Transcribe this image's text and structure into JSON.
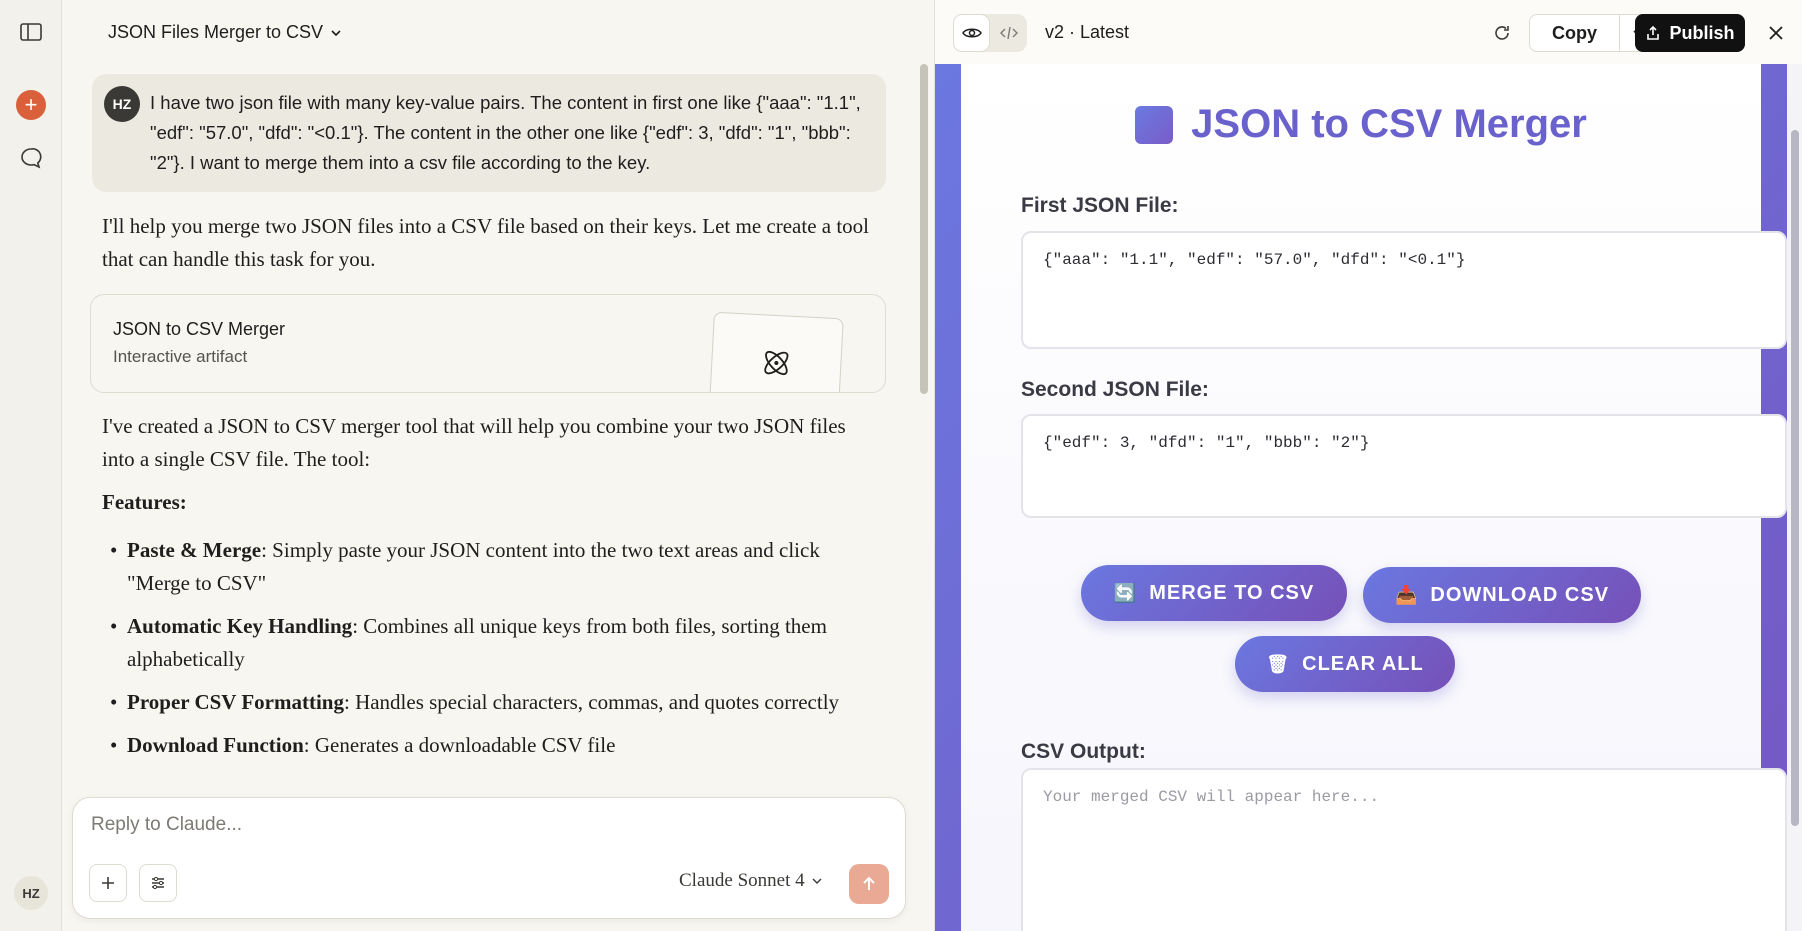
{
  "rail": {
    "user_initials": "HZ"
  },
  "chat": {
    "title": "JSON Files Merger to CSV",
    "user_initials": "HZ",
    "user_message": "I have two json file with many key-value pairs. The content in first one like {\"aaa\": \"1.1\", \"edf\": \"57.0\", \"dfd\": \"<0.1\"}. The content in the other one like {\"edf\": 3, \"dfd\": \"1\", \"bbb\": \"2\"}. I want to merge them into a csv file according to the key.",
    "reply_intro": "I'll help you merge two JSON files into a CSV file based on their keys. Let me create a tool that can handle this task for you.",
    "artifact_card": {
      "title": "JSON to CSV Merger",
      "subtitle": "Interactive artifact"
    },
    "reply_body": "I've created a JSON to CSV merger tool that will help you combine your two JSON files into a single CSV file. The tool:",
    "features_heading": "Features:",
    "features": [
      {
        "title": "Paste & Merge",
        "text": ": Simply paste your JSON content into the two text areas and click \"Merge to CSV\""
      },
      {
        "title": "Automatic Key Handling",
        "text": ": Combines all unique keys from both files, sorting them alphabetically"
      },
      {
        "title": "Proper CSV Formatting",
        "text": ": Handles special characters, commas, and quotes correctly"
      },
      {
        "title": "Download Function",
        "text": ": Generates a downloadable CSV file"
      }
    ],
    "reply_box": {
      "placeholder": "Reply to Claude...",
      "model": "Claude Sonnet 4"
    }
  },
  "artifact_header": {
    "version": "v2 · Latest",
    "copy_label": "Copy",
    "publish_label": "Publish"
  },
  "artifact": {
    "title": "JSON to CSV Merger",
    "first_label": "First JSON File:",
    "first_value": "{\"aaa\": \"1.1\", \"edf\": \"57.0\", \"dfd\": \"<0.1\"}",
    "second_label": "Second JSON File:",
    "second_value": "{\"edf\": 3, \"dfd\": \"1\", \"bbb\": \"2\"}",
    "merge_label": "MERGE TO CSV",
    "merge_icon": "🔄",
    "download_label": "DOWNLOAD CSV",
    "download_icon": "📥",
    "clear_label": "CLEAR ALL",
    "clear_icon": "🗑",
    "output_label": "CSV Output:",
    "output_placeholder": "Your merged CSV will appear here..."
  },
  "colors": {
    "accent_orange": "#d9603b",
    "gradient_start": "#6b78e0",
    "gradient_end": "#7556c0",
    "title_purple": "#6a62cc"
  }
}
